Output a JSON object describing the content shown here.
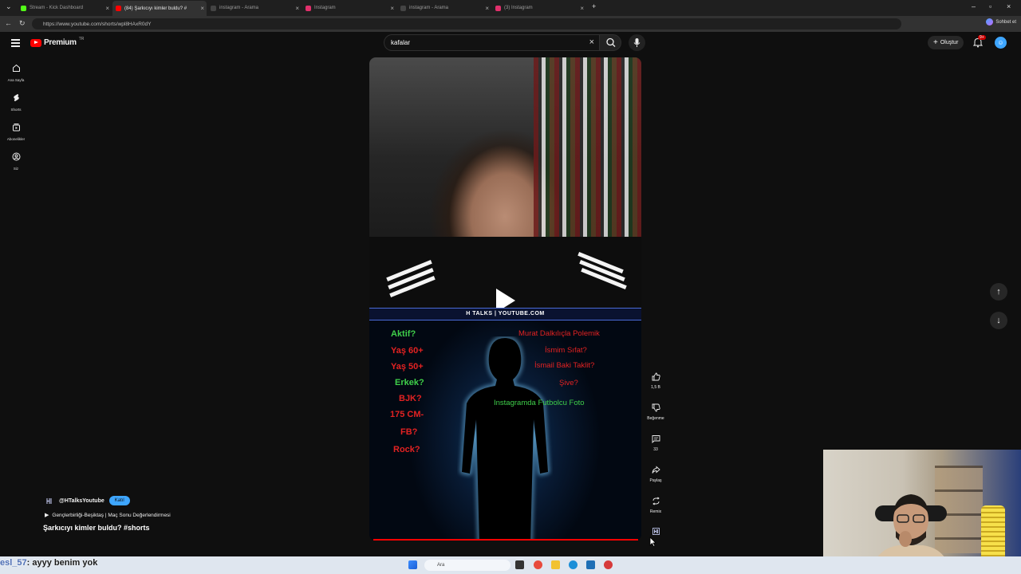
{
  "browser": {
    "tabs": [
      {
        "label": "Stream - Kick Dashboard",
        "color": "#53fc18"
      },
      {
        "label": "(84) Şarkıcıyı kimler buldu? #",
        "color": "#ff0000"
      },
      {
        "label": "instagram - Arama",
        "color": "#444444"
      },
      {
        "label": "Instagram",
        "color": "#e1306c"
      },
      {
        "label": "instagram - Arama",
        "color": "#444444"
      },
      {
        "label": "(3) Instagram",
        "color": "#e1306c"
      }
    ],
    "new_tab": "+",
    "url": "https://www.youtube.com/shorts/wpl8HAxR0dY",
    "chat_button": "Sohbet et"
  },
  "youtube": {
    "logo_text": "Premium",
    "logo_region": "TR",
    "search_value": "kafalar",
    "create_label": "Oluştur",
    "notification_count": "9+",
    "rail": [
      {
        "label": "Ana Sayfa",
        "icon": "home-icon"
      },
      {
        "label": "Shorts",
        "icon": "shorts-icon"
      },
      {
        "label": "Abonelikler",
        "icon": "subscriptions-icon"
      },
      {
        "label": "Siz",
        "icon": "you-icon"
      }
    ],
    "video": {
      "banner": "H TALKS | YOUTUBE.COM",
      "left_lines": [
        {
          "text": "Aktif?",
          "color": "#3fcf4a"
        },
        {
          "text": "Yaş 60+",
          "color": "#e32222"
        },
        {
          "text": "Yaş 50+",
          "color": "#e32222"
        },
        {
          "text": "Erkek?",
          "color": "#3fcf4a"
        },
        {
          "text": "BJK?",
          "color": "#e32222"
        },
        {
          "text": "175 CM-",
          "color": "#e32222"
        },
        {
          "text": "FB?",
          "color": "#e32222"
        },
        {
          "text": "Rock?",
          "color": "#e32222"
        }
      ],
      "right_lines": [
        {
          "text": "Murat Dalkılıçla Polemik",
          "color": "#e32222"
        },
        {
          "text": "İsmim Sıfat?",
          "color": "#e32222"
        },
        {
          "text": "İsmail Baki Taklit?",
          "color": "#e32222"
        },
        {
          "text": "Şive?",
          "color": "#e32222"
        },
        {
          "text": "Instagramda Futbolcu Foto",
          "color": "#3fcf4a"
        }
      ],
      "progress_fraction": 1.0
    },
    "actions": {
      "like_count": "1,5 B",
      "dislike_label": "Beğenme",
      "comment_count": "33",
      "share_label": "Paylaş",
      "remix_label": "Remix"
    },
    "channel": {
      "handle": "@HTalksYoutube",
      "subscribe_label": "Katıl",
      "playlist": "Gençlerbirliği-Beşiktaş | Maç Sonu Değerlendirmesi",
      "title": "Şarkıcıyı kimler buldu? #shorts"
    }
  },
  "overlay": {
    "chat_user": "esl_57",
    "chat_message": ": ayyy benim yok"
  },
  "taskbar": {
    "search_placeholder": "Ara"
  }
}
